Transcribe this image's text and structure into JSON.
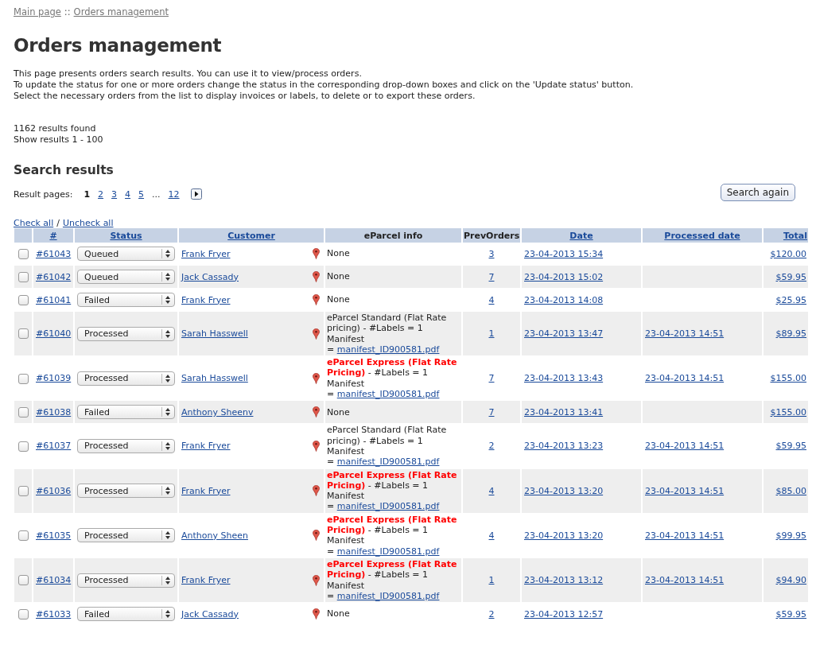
{
  "breadcrumb": [
    {
      "label": "Main page"
    },
    {
      "label": "Orders management"
    }
  ],
  "breadcrumb_separator": "::",
  "title": "Orders management",
  "intro": [
    "This page presents orders search results. You can use it to view/process orders.",
    "To update the status for one or more orders change the status in the corresponding drop-down boxes and click on the 'Update status' button.",
    "Select the necessary orders from the list to display invoices or labels, to delete or to export these orders."
  ],
  "results_found": "1162 results found",
  "results_range": "Show results 1 - 100",
  "section_title": "Search results",
  "search_again": "Search again",
  "pager": {
    "label": "Result pages:",
    "pages": [
      {
        "label": "1",
        "selected": true
      },
      {
        "label": "2",
        "selected": false
      },
      {
        "label": "3",
        "selected": false
      },
      {
        "label": "4",
        "selected": false
      },
      {
        "label": "5",
        "selected": false
      },
      {
        "label": "...",
        "kind": "gap"
      },
      {
        "label": "12",
        "selected": false
      }
    ]
  },
  "check_all": "Check all",
  "check_sep": "/",
  "uncheck_all": "Uncheck all",
  "table": {
    "columns": [
      {
        "sortable": false
      },
      {
        "label": "#",
        "sortable": true
      },
      {
        "label": "Status",
        "sortable": true
      },
      {
        "label": "Customer",
        "sortable": true
      },
      {
        "label": "eParcel info",
        "sortable": false
      },
      {
        "label": "PrevOrders",
        "sortable": false
      },
      {
        "label": "Date",
        "sortable": true
      },
      {
        "label": "Processed date",
        "sortable": true
      },
      {
        "label": "Total",
        "sortable": true
      }
    ],
    "rows": [
      {
        "checked": false,
        "id": "#61043",
        "status": "Queued",
        "customer": "Frank Fryer",
        "eparcel": {
          "kind": "none",
          "text": "None"
        },
        "prev": "3",
        "date": "23-04-2013 15:34",
        "total": "$120.00"
      },
      {
        "checked": false,
        "id": "#61042",
        "status": "Queued",
        "customer": "Jack Cassady",
        "eparcel": {
          "kind": "none",
          "text": "None"
        },
        "prev": "7",
        "date": "23-04-2013 15:02",
        "total": "$59.95"
      },
      {
        "checked": false,
        "id": "#61041",
        "status": "Failed",
        "customer": "Frank Fryer",
        "eparcel": {
          "kind": "none",
          "text": "None"
        },
        "prev": "4",
        "date": "23-04-2013 14:08",
        "total": "$25.95"
      },
      {
        "checked": false,
        "id": "#61040",
        "status": "Processed",
        "customer": "Sarah Hasswell",
        "eparcel": {
          "kind": "standard",
          "service": "eParcel Standard (Flat Rate pricing)",
          "labels": "- #Labels = 1",
          "manifest": "Manifest",
          "equals": "=",
          "file": "manifest_ID900581.pdf"
        },
        "prev": "1",
        "date": "23-04-2013 13:47",
        "processed": "23-04-2013 14:51",
        "total": "$89.95"
      },
      {
        "checked": false,
        "id": "#61039",
        "status": "Processed",
        "customer": "Sarah Hasswell",
        "eparcel": {
          "kind": "express",
          "service": "eParcel Express (Flat Rate Pricing)",
          "labels": "- #Labels = 1",
          "manifest": "Manifest",
          "equals": "=",
          "file": "manifest_ID900581.pdf"
        },
        "prev": "7",
        "date": "23-04-2013 13:43",
        "processed": "23-04-2013 14:51",
        "total": "$155.00"
      },
      {
        "checked": false,
        "id": "#61038",
        "status": "Failed",
        "customer": "Anthony Sheenv",
        "eparcel": {
          "kind": "none",
          "text": "None"
        },
        "prev": "7",
        "date": "23-04-2013 13:41",
        "total": "$155.00"
      },
      {
        "checked": false,
        "id": "#61037",
        "status": "Processed",
        "customer": "Frank Fryer",
        "eparcel": {
          "kind": "standard",
          "service": "eParcel Standard (Flat Rate pricing)",
          "labels": "- #Labels = 1",
          "manifest": "Manifest",
          "equals": "=",
          "file": "manifest_ID900581.pdf"
        },
        "prev": "2",
        "date": "23-04-2013 13:23",
        "processed": "23-04-2013 14:51",
        "total": "$59.95"
      },
      {
        "checked": false,
        "id": "#61036",
        "status": "Processed",
        "customer": "Frank Fryer",
        "eparcel": {
          "kind": "express",
          "service": "eParcel Express (Flat Rate Pricing)",
          "labels": "- #Labels = 1",
          "manifest": "Manifest",
          "equals": "=",
          "file": "manifest_ID900581.pdf"
        },
        "prev": "4",
        "date": "23-04-2013 13:20",
        "processed": "23-04-2013 14:51",
        "total": "$85.00"
      },
      {
        "checked": false,
        "id": "#61035",
        "status": "Processed",
        "customer": "Anthony Sheen",
        "eparcel": {
          "kind": "express",
          "service": "eParcel Express (Flat Rate Pricing)",
          "labels": "- #Labels = 1",
          "manifest": "Manifest",
          "equals": "=",
          "file": "manifest_ID900581.pdf"
        },
        "prev": "4",
        "date": "23-04-2013 13:20",
        "processed": "23-04-2013 14:51",
        "total": "$99.95"
      },
      {
        "checked": false,
        "id": "#61034",
        "status": "Processed",
        "customer": "Frank Fryer",
        "eparcel": {
          "kind": "express",
          "service": "eParcel Express (Flat Rate Pricing)",
          "labels": "- #Labels = 1",
          "manifest": "Manifest",
          "equals": "=",
          "file": "manifest_ID900581.pdf"
        },
        "prev": "1",
        "date": "23-04-2013 13:12",
        "processed": "23-04-2013 14:51",
        "total": "$94.90"
      },
      {
        "checked": false,
        "id": "#61033",
        "status": "Failed",
        "customer": "Jack Cassady",
        "eparcel": {
          "kind": "none",
          "text": "None"
        },
        "prev": "2",
        "date": "23-04-2013 12:57",
        "total": "$59.95"
      }
    ]
  }
}
